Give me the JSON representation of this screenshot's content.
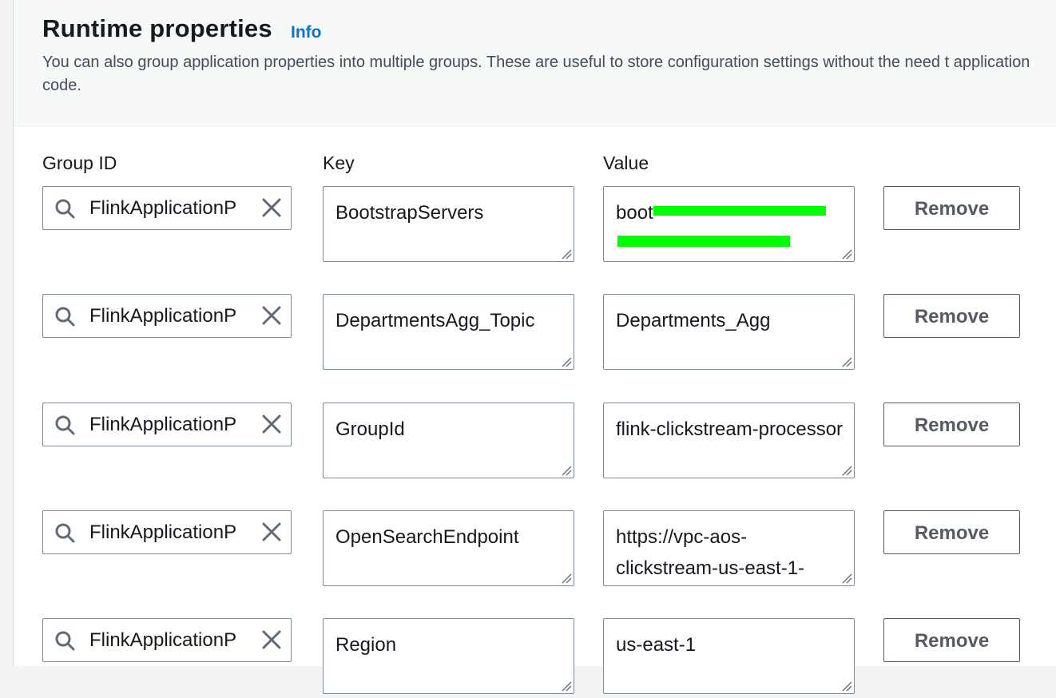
{
  "header": {
    "title": "Runtime properties",
    "info_label": "Info",
    "description": "You can also group application properties into multiple groups. These are useful to store configuration settings without the need t application code."
  },
  "columns": {
    "group_id": "Group ID",
    "key": "Key",
    "value": "Value"
  },
  "remove_label": "Remove",
  "rows": [
    {
      "group": "FlinkApplicationP",
      "key": "BootstrapServers",
      "value": "boot-",
      "value_redacted": true
    },
    {
      "group": "FlinkApplicationP",
      "key": "DepartmentsAgg_Topic",
      "value": "Departments_Agg"
    },
    {
      "group": "FlinkApplicationP",
      "key": "GroupId",
      "value": "flink-clickstream-processor"
    },
    {
      "group": "FlinkApplicationP",
      "key": "OpenSearchEndpoint",
      "value": "https://vpc-aos-clickstream-us-east-1-"
    },
    {
      "group": "FlinkApplicationP",
      "key": "Region",
      "value": "us-east-1"
    }
  ],
  "colors": {
    "link": "#0972d3",
    "border": "#7d8998",
    "redaction": "#00ff00"
  }
}
